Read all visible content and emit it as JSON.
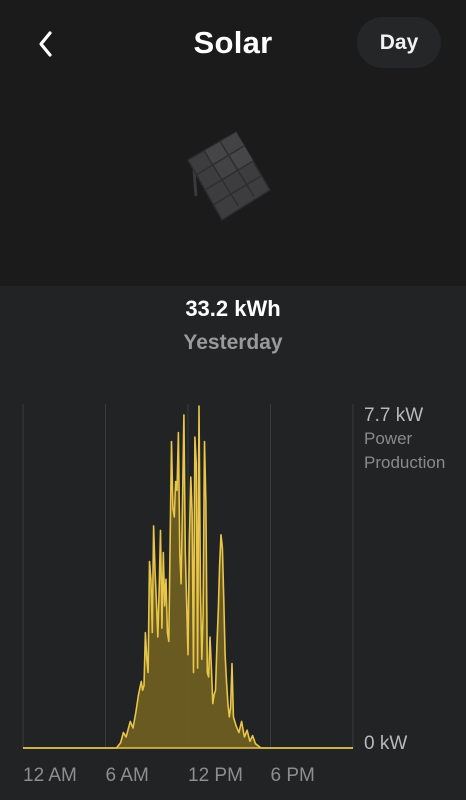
{
  "header": {
    "title": "Solar",
    "period_button": "Day",
    "back_icon": "chevron-left-icon"
  },
  "hero": {
    "image": "solar-panel-icon"
  },
  "summary": {
    "total": "33.2 kWh",
    "period": "Yesterday"
  },
  "colors": {
    "accent": "#e8c64a",
    "fill": "#6e5e22",
    "background": "#222325",
    "muted_text": "#9a9a9a"
  },
  "chart_data": {
    "type": "area",
    "ylabel_lines": [
      "Power",
      "Production"
    ],
    "y_max_label": "7.7 kW",
    "y_min_label": "0 kW",
    "ylim": [
      0,
      7.7
    ],
    "xlim": [
      0,
      24
    ],
    "x_tick_labels": [
      "12 AM",
      "6 AM",
      "12 PM",
      "6 PM"
    ],
    "x_ticks": [
      0,
      6,
      12,
      18
    ],
    "grid": true,
    "x": [
      0,
      6.8,
      7.1,
      7.3,
      7.5,
      7.8,
      8.0,
      8.2,
      8.4,
      8.6,
      8.7,
      8.8,
      8.9,
      9.0,
      9.1,
      9.2,
      9.3,
      9.4,
      9.5,
      9.6,
      9.7,
      9.8,
      9.9,
      10.0,
      10.1,
      10.2,
      10.3,
      10.4,
      10.5,
      10.6,
      10.7,
      10.8,
      10.9,
      11.0,
      11.1,
      11.2,
      11.3,
      11.4,
      11.5,
      11.6,
      11.7,
      11.8,
      11.9,
      12.0,
      12.1,
      12.2,
      12.3,
      12.4,
      12.5,
      12.6,
      12.7,
      12.8,
      12.9,
      13.0,
      13.1,
      13.2,
      13.3,
      13.4,
      13.5,
      13.6,
      13.7,
      13.8,
      13.9,
      14.0,
      14.1,
      14.2,
      14.3,
      14.4,
      14.5,
      14.6,
      14.7,
      14.8,
      14.9,
      15.0,
      15.1,
      15.2,
      15.3,
      15.5,
      15.7,
      15.9,
      16.1,
      16.3,
      16.5,
      16.7,
      16.9,
      17.1,
      17.3,
      17.5,
      17.7,
      18.0,
      24
    ],
    "y": [
      0,
      0,
      0.12,
      0.35,
      0.25,
      0.6,
      0.45,
      0.8,
      1.2,
      1.5,
      1.3,
      1.4,
      2.6,
      2.0,
      1.7,
      4.2,
      3.8,
      2.6,
      5.0,
      4.0,
      3.3,
      2.5,
      3.5,
      4.9,
      2.7,
      4.4,
      3.2,
      3.8,
      2.6,
      2.4,
      4.6,
      6.9,
      5.4,
      5.2,
      6.0,
      5.8,
      7.1,
      4.4,
      3.7,
      5.5,
      7.5,
      4.4,
      3.3,
      2.1,
      4.7,
      6.1,
      5.3,
      1.7,
      7.0,
      6.4,
      1.8,
      7.7,
      3.6,
      2.0,
      3.0,
      6.9,
      5.5,
      1.7,
      1.6,
      2.5,
      1.8,
      1.0,
      1.2,
      1.3,
      2.3,
      3.1,
      4.1,
      4.8,
      4.5,
      3.4,
      2.1,
      1.5,
      1.0,
      0.7,
      0.9,
      1.9,
      0.7,
      0.5,
      0.35,
      0.6,
      0.25,
      0.4,
      0.15,
      0.28,
      0.1,
      0.05,
      0,
      0,
      0,
      0,
      0
    ]
  }
}
